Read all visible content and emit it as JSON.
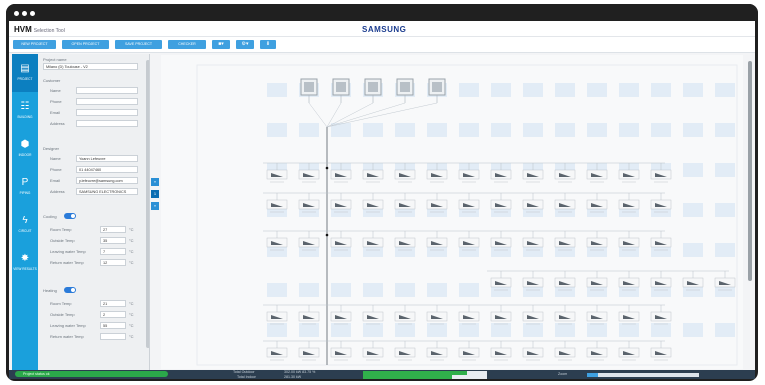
{
  "header": {
    "app_name": "HVM",
    "app_subtitle": "Selection Tool",
    "brand": "SAMSUNG"
  },
  "toolbar": [
    {
      "label": "NEW PROJECT",
      "icon": ""
    },
    {
      "label": "OPEN PROJECT",
      "icon": ""
    },
    {
      "label": "SAVE PROJECT",
      "icon": ""
    },
    {
      "label": "CHECKER",
      "icon": ""
    },
    {
      "label": "",
      "icon": "■▾"
    },
    {
      "label": "",
      "icon": "⚙▾"
    },
    {
      "label": "",
      "icon": "⬇"
    }
  ],
  "rail": [
    {
      "label": "PROJECT",
      "icon_name": "document-icon",
      "glyph": "▤"
    },
    {
      "label": "BUILDING",
      "icon_name": "building-icon",
      "glyph": "☷"
    },
    {
      "label": "INDOOR",
      "icon_name": "cube-icon",
      "glyph": "⬢"
    },
    {
      "label": "PIPING",
      "icon_name": "pipe-icon",
      "glyph": "P"
    },
    {
      "label": "CIRCUIT",
      "icon_name": "bolt-icon",
      "glyph": "ϟ"
    },
    {
      "label": "VIEW RESULTS",
      "icon_name": "share-icon",
      "glyph": "✸"
    }
  ],
  "panel": {
    "project_name_label": "Project name",
    "project_name_value": "Milano (D) Toulouse - V2",
    "customer_label": "Customer",
    "customer_fields": [
      {
        "label": "Name",
        "value": ""
      },
      {
        "label": "Phone",
        "value": ""
      },
      {
        "label": "Email",
        "value": ""
      },
      {
        "label": "Address",
        "value": ""
      }
    ],
    "designer_label": "Designer",
    "designer_fields": [
      {
        "label": "Name",
        "value": "Yoann Lefeuvre"
      },
      {
        "label": "Phone",
        "value": "01 44047460"
      },
      {
        "label": "Email",
        "value": "y.lefeuvre@samsung.com"
      },
      {
        "label": "Address",
        "value": "SAMSUNG ELECTRONICS"
      }
    ],
    "cooling_label": "Cooling",
    "cooling_fields": [
      {
        "label": "Room Temp",
        "value": "27",
        "unit": "°C"
      },
      {
        "label": "Outside Temp",
        "value": "35",
        "unit": "°C"
      },
      {
        "label": "Leaving water Temp",
        "value": "7",
        "unit": "°C"
      },
      {
        "label": "Return water Temp",
        "value": "12",
        "unit": "°C"
      }
    ],
    "heating_label": "Heating",
    "heating_fields": [
      {
        "label": "Room Temp",
        "value": "21",
        "unit": "°C"
      },
      {
        "label": "Outside Temp",
        "value": "2",
        "unit": "°C"
      },
      {
        "label": "Leaving water Temp",
        "value": "55",
        "unit": "°C"
      },
      {
        "label": "Return water Temp",
        "value": "",
        "unit": "°C"
      }
    ]
  },
  "side_tabs": [
    "«",
    "1",
    "»"
  ],
  "status": {
    "left_text": "Project status ok",
    "total_outdoor_label": "Total Outdoor",
    "total_indoor_label": "Total Indoor",
    "total_outdoor_value": "302.00 kW 83.75 %",
    "total_indoor_value": "281.30 kW",
    "outdoor_progress": 0.84,
    "indoor_progress": 0.72,
    "zoom_label": "Zoom",
    "zoom_level": 0.1
  },
  "colors": {
    "accent": "#1aa0dc",
    "status_ok": "#2ba84a",
    "grid_cell": "#dde9f4"
  }
}
